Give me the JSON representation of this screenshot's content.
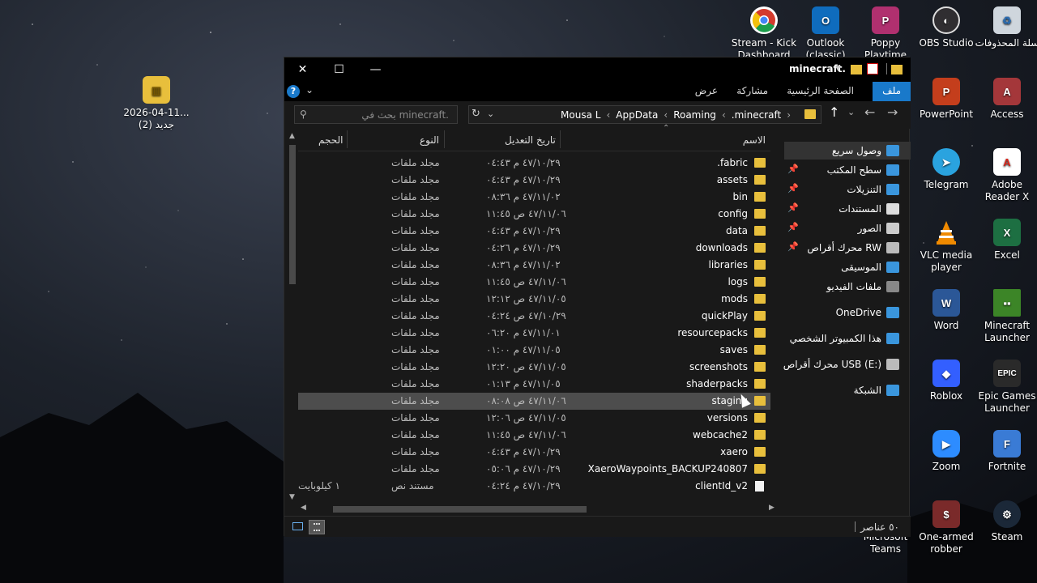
{
  "desktop_icons": [
    {
      "label": "Stream - Kick Dashboard",
      "icon": "chrome-icon",
      "color": "#d33a2c"
    },
    {
      "label": "Outlook (classic)",
      "icon": "outlook-icon",
      "color": "#0f6cbd"
    },
    {
      "label": "Poppy Playtime",
      "icon": "poppy-playtime-icon",
      "color": "#b0306f"
    },
    {
      "label": "OBS Studio",
      "icon": "obs-icon",
      "color": "#302e31"
    },
    {
      "label": "سلة المحذوفات",
      "icon": "recycle-bin-icon",
      "color": "#cfd6dd"
    },
    {
      "label": "2026-04-11... جديد (2)",
      "icon": "zip-folder-icon",
      "color": "#e8bf3c"
    },
    {
      "label": "PowerPoint",
      "icon": "powerpoint-icon",
      "color": "#c43e1c"
    },
    {
      "label": "Access",
      "icon": "access-icon",
      "color": "#a4373a"
    },
    {
      "label": "Telegram",
      "icon": "telegram-icon",
      "color": "#2aa3df"
    },
    {
      "label": "Adobe Reader X",
      "icon": "adobe-reader-icon",
      "color": "#d7261c"
    },
    {
      "label": "VLC media player",
      "icon": "vlc-icon",
      "color": "#f08a00"
    },
    {
      "label": "Excel",
      "icon": "excel-icon",
      "color": "#1d6f42"
    },
    {
      "label": "Word",
      "icon": "word-icon",
      "color": "#2b5797"
    },
    {
      "label": "Minecraft Launcher",
      "icon": "minecraft-icon",
      "color": "#3c8527"
    },
    {
      "label": "Roblox",
      "icon": "roblox-icon",
      "color": "#335fff"
    },
    {
      "label": "Epic Games Launcher",
      "icon": "epic-games-icon",
      "color": "#2a2a2a"
    },
    {
      "label": "Zoom",
      "icon": "zoom-icon",
      "color": "#2d8cff"
    },
    {
      "label": "Fortnite",
      "icon": "fortnite-icon",
      "color": "#3a7bd5"
    },
    {
      "label": "Microsoft Teams",
      "icon": "teams-icon",
      "color": "#4b53bc"
    },
    {
      "label": "One-armed robber",
      "icon": "one-armed-robber-icon",
      "color": "#7a2a2a"
    },
    {
      "label": "Steam",
      "icon": "steam-icon",
      "color": "#1b2838"
    }
  ],
  "window": {
    "title": "minecraft.",
    "close": "✕",
    "maximize": "☐",
    "minimize": "—",
    "ribbon_tabs": {
      "file": "ملف",
      "home": "الصفحة الرئيسية",
      "share": "مشاركة",
      "view": "عرض"
    },
    "help": "?",
    "search_placeholder": "بحث في minecraft.",
    "breadcrumbs": [
      "Mousa L",
      "AppData",
      "Roaming",
      ".minecraft"
    ],
    "columns": {
      "name": "الاسم",
      "date": "تاريخ التعديل",
      "type": "النوع",
      "size": "الحجم"
    },
    "status": "٥٠ عناصر",
    "accent": "#1979ca"
  },
  "files": [
    {
      "name": ".fabric",
      "date": "٤٧/١٠/٢٩ م ٠٤:٤٣",
      "type": "مجلد ملفات",
      "size": "",
      "kind": "folder"
    },
    {
      "name": "assets",
      "date": "٤٧/١٠/٢٩ م ٠٤:٤٣",
      "type": "مجلد ملفات",
      "size": "",
      "kind": "folder"
    },
    {
      "name": "bin",
      "date": "٤٧/١١/٠٢ م ٠٨:٣٦",
      "type": "مجلد ملفات",
      "size": "",
      "kind": "folder"
    },
    {
      "name": "config",
      "date": "٤٧/١١/٠٦ ص ١١:٤٥",
      "type": "مجلد ملفات",
      "size": "",
      "kind": "folder"
    },
    {
      "name": "data",
      "date": "٤٧/١٠/٢٩ م ٠٤:٤٣",
      "type": "مجلد ملفات",
      "size": "",
      "kind": "folder"
    },
    {
      "name": "downloads",
      "date": "٤٧/١٠/٢٩ م ٠٤:٢٦",
      "type": "مجلد ملفات",
      "size": "",
      "kind": "folder"
    },
    {
      "name": "libraries",
      "date": "٤٧/١١/٠٢ م ٠٨:٣٦",
      "type": "مجلد ملفات",
      "size": "",
      "kind": "folder"
    },
    {
      "name": "logs",
      "date": "٤٧/١١/٠٦ ص ١١:٤٥",
      "type": "مجلد ملفات",
      "size": "",
      "kind": "folder"
    },
    {
      "name": "mods",
      "date": "٤٧/١١/٠٥ ص ١٢:١٢",
      "type": "مجلد ملفات",
      "size": "",
      "kind": "folder"
    },
    {
      "name": "quickPlay",
      "date": "٤٧/١٠/٢٩ ص ٠٤:٢٤",
      "type": "مجلد ملفات",
      "size": "",
      "kind": "folder"
    },
    {
      "name": "resourcepacks",
      "date": "٤٧/١١/٠١ م ٠٦:٢٠",
      "type": "مجلد ملفات",
      "size": "",
      "kind": "folder"
    },
    {
      "name": "saves",
      "date": "٤٧/١١/٠٥ م ٠١:٠٠",
      "type": "مجلد ملفات",
      "size": "",
      "kind": "folder"
    },
    {
      "name": "screenshots",
      "date": "٤٧/١١/٠٥ ص ١٢:٢٠",
      "type": "مجلد ملفات",
      "size": "",
      "kind": "folder"
    },
    {
      "name": "shaderpacks",
      "date": "٤٧/١١/٠٥ م ٠١:١٣",
      "type": "مجلد ملفات",
      "size": "",
      "kind": "folder"
    },
    {
      "name": "staging",
      "date": "٤٧/١١/٠٦ ص ٠٨:٠٨",
      "type": "مجلد ملفات",
      "size": "",
      "kind": "folder"
    },
    {
      "name": "versions",
      "date": "٤٧/١١/٠٥ ص ١٢:٠٦",
      "type": "مجلد ملفات",
      "size": "",
      "kind": "folder"
    },
    {
      "name": "webcache2",
      "date": "٤٧/١١/٠٦ ص ١١:٤٥",
      "type": "مجلد ملفات",
      "size": "",
      "kind": "folder"
    },
    {
      "name": "xaero",
      "date": "٤٧/١٠/٢٩ م ٠٤:٤٣",
      "type": "مجلد ملفات",
      "size": "",
      "kind": "folder"
    },
    {
      "name": "XaeroWaypoints_BACKUP240807",
      "date": "٤٧/١٠/٢٩ م ٠٥:٠٦",
      "type": "مجلد ملفات",
      "size": "",
      "kind": "folder"
    },
    {
      "name": "clientId_v2",
      "date": "٤٧/١٠/٢٩ م ٠٤:٢٤",
      "type": "مستند نص",
      "size": "١ كيلوبايت",
      "kind": "doc"
    }
  ],
  "selected_file": "staging",
  "nav_pane": [
    {
      "label": "وصول سريع",
      "icon": "star-icon",
      "color": "#3a96dd",
      "pinned": false,
      "active": true
    },
    {
      "label": "سطح المكتب",
      "icon": "desktop-icon",
      "color": "#3a96dd",
      "pinned": true
    },
    {
      "label": "التنزيلات",
      "icon": "download-icon",
      "color": "#3a96dd",
      "pinned": true
    },
    {
      "label": "المستندات",
      "icon": "documents-icon",
      "color": "#dddddd",
      "pinned": true
    },
    {
      "label": "الصور",
      "icon": "pictures-icon",
      "color": "#cccccc",
      "pinned": true
    },
    {
      "label": "محرك أقراص RW",
      "icon": "drive-icon",
      "color": "#bbbbbb",
      "pinned": true
    },
    {
      "label": "الموسيقى",
      "icon": "music-icon",
      "color": "#3a96dd",
      "pinned": false
    },
    {
      "label": "ملفات الفيديو",
      "icon": "video-icon",
      "color": "#888888",
      "pinned": false
    },
    {
      "label": "OneDrive",
      "icon": "onedrive-icon",
      "color": "#3a96dd",
      "pinned": false
    },
    {
      "label": "هذا الكمبيوتر الشخصي",
      "icon": "this-pc-icon",
      "color": "#3a96dd",
      "pinned": false
    },
    {
      "label": "محرك أقراص USB (E:)",
      "icon": "usb-drive-icon",
      "color": "#bbbbbb",
      "pinned": false
    },
    {
      "label": "الشبكة",
      "icon": "network-icon",
      "color": "#3a96dd",
      "pinned": false
    }
  ]
}
